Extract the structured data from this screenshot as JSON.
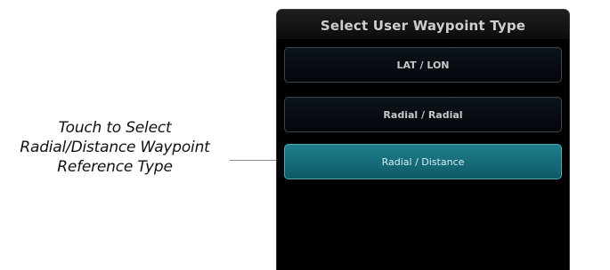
{
  "callout": {
    "line1": "Touch to Select",
    "line2": "Radial/Distance Waypoint",
    "line3": "Reference Type"
  },
  "dialog": {
    "title": "Select User Waypoint Type",
    "options": [
      {
        "label": "LAT / LON",
        "selected": false
      },
      {
        "label": "Radial / Radial",
        "selected": false
      },
      {
        "label": "Radial / Distance",
        "selected": true
      }
    ]
  },
  "colors": {
    "panel_background": "#000000",
    "selected_option": "#1a7481",
    "option_border": "#3d4650"
  }
}
